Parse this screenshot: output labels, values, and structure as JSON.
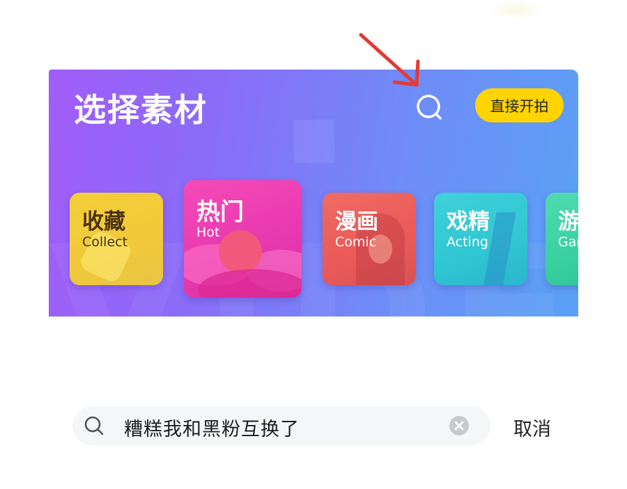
{
  "banner": {
    "title": "选择素材",
    "shoot_button": "直接开拍",
    "search_icon": "search-icon"
  },
  "categories": [
    {
      "name": "收藏",
      "english": "Collect"
    },
    {
      "name": "热门",
      "english": "Hot"
    },
    {
      "name": "漫画",
      "english": "Comic"
    },
    {
      "name": "戏精",
      "english": "Acting"
    },
    {
      "name": "游",
      "english": "Gar"
    }
  ],
  "annotation": {
    "arrow_color": "#e53935"
  },
  "search": {
    "query": "糟糕我和黑粉互换了",
    "search_icon": "search-icon",
    "clear_icon": "clear-icon",
    "cancel_label": "取消"
  },
  "colors": {
    "accent_yellow": "#ffd400",
    "banner_start": "#a15cf7",
    "banner_end": "#5aa1f6"
  }
}
